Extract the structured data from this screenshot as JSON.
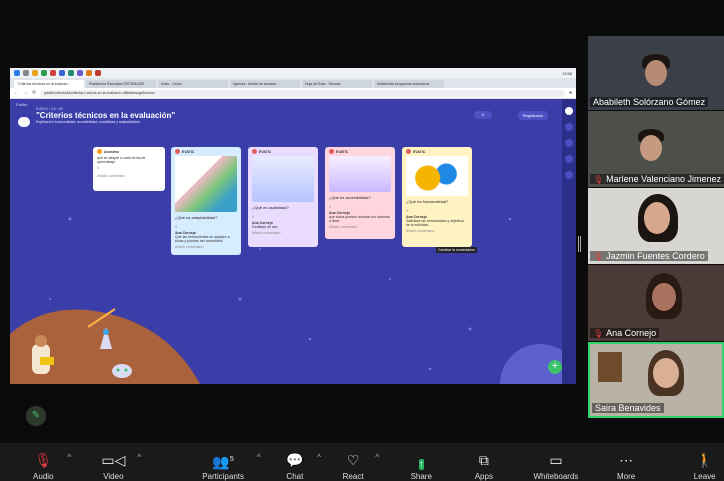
{
  "browser": {
    "tabs": [
      "\"Criterios técnicos en la evaluaci...",
      "Plataforma Educativa SISTEMASEI",
      "Inicio - Genio",
      "Agenda - Month de semana",
      "Hoja de Ruta - Seudos",
      "Multimedia programas educativos"
    ],
    "url": "padlet.com/ea2d/criterios-t-cnicos-en-la-evaluaci-n-f8fbsdrwcgx3mmsw",
    "clock": "13:58"
  },
  "padlet": {
    "label": "Padlet",
    "meta": "EVATIC • 3 h • 80",
    "title": "\"Criterios técnicos en la evaluación\"",
    "subtitle": "Explicación funcionalidad, accesibilidad, usabilidad y adaptabilidad",
    "register_label": "Registrarse",
    "tooltip": "Cambiar la comentarios",
    "cards": [
      {
        "author": "Anónimo",
        "question": "que se adapte a cada forma de aprendizaje",
        "likes": "0",
        "add_comment": "Añadir comentario"
      },
      {
        "author": "EVATIC",
        "question": "¿Qué es adaptabilidad?",
        "likes": "0",
        "commenter": "Ana Cornejo",
        "comment": "Que las herramientas se adapten a todas y puedan ser accesibles!",
        "add_comment": "Añadir comentario"
      },
      {
        "author": "EVATIC",
        "question": "¿Qué es usabilidad?",
        "likes": "0",
        "commenter": "Ana Cornejo",
        "comment": "Facilidad de uso",
        "add_comment": "Añadir comentario"
      },
      {
        "author": "EVATIC",
        "question": "¿Qué es accesibilidad?",
        "likes": "0",
        "commenter": "Ana Cornejo",
        "comment": "que todos pueden acceder sin barreras a linea",
        "add_comment": "Añadir comentario"
      },
      {
        "author": "EVATIC",
        "question": "¿Qué es funcionalidad?",
        "likes": "0",
        "commenter": "Ana Cornejo",
        "comment": "Satisface las necesidades y objetivos de la actividad",
        "add_comment": "Añadir comentario"
      }
    ]
  },
  "participants": [
    {
      "name": "Ababileth Solórzano Gómez",
      "muted": false
    },
    {
      "name": "Marlene Valenciano Jimenez",
      "muted": true
    },
    {
      "name": "Jazmin Fuentes Cordero",
      "muted": true
    },
    {
      "name": "Ana Cornejo",
      "muted": true
    },
    {
      "name": "Saira Benavides",
      "muted": false
    }
  ],
  "toolbar": {
    "audio": "Audio",
    "video": "Video",
    "participants": "Participants",
    "participants_count": "5",
    "chat": "Chat",
    "react": "React",
    "share": "Share",
    "apps": "Apps",
    "whiteboards": "Whiteboards",
    "more": "More",
    "leave": "Leave"
  },
  "colors": {
    "board_bg": "#3b3ea8",
    "active_speaker": "#2fd46a",
    "share_green": "#23b45f",
    "muted_red": "#e63c3c"
  }
}
